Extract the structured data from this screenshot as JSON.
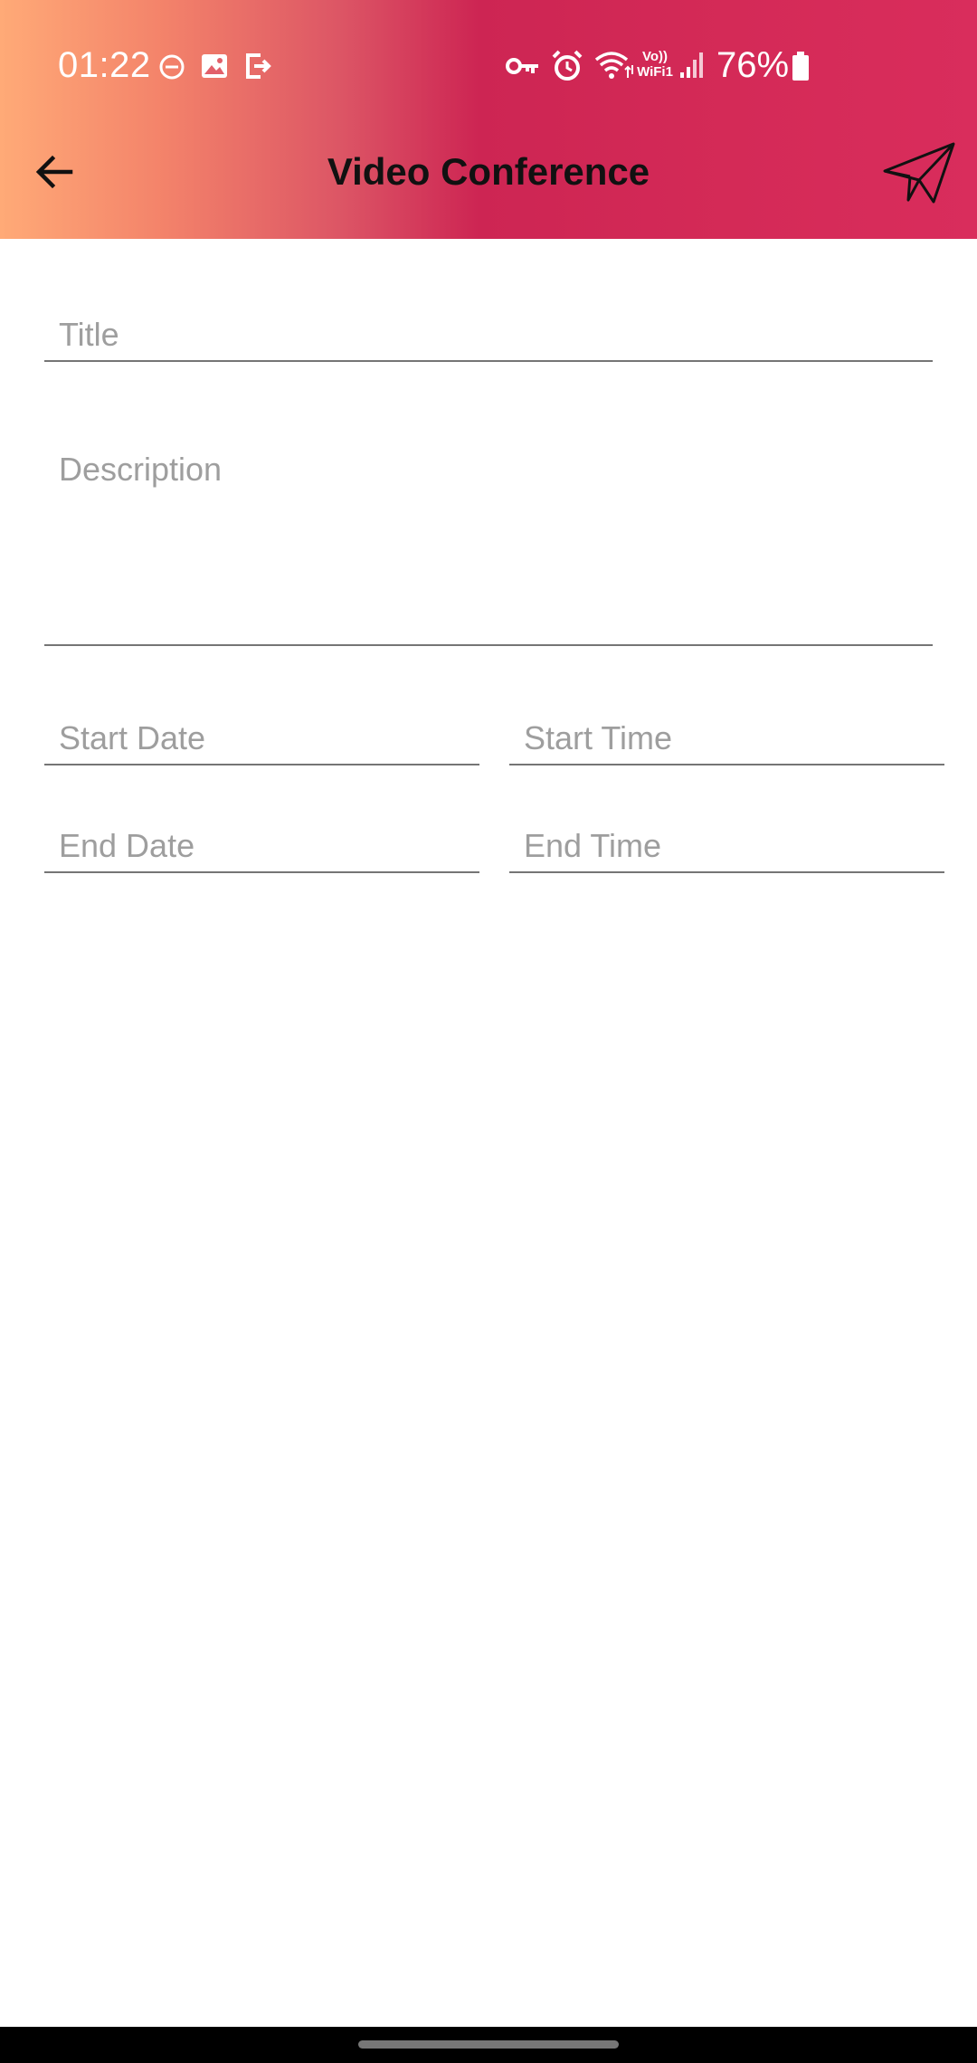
{
  "status_bar": {
    "time": "01:22",
    "battery_percent": "76%",
    "vowifi_top": "Vo))",
    "vowifi_bottom": "WiFi1",
    "icons": [
      "dnd-icon",
      "gallery-icon",
      "exit-icon",
      "vpn-key-icon",
      "alarm-icon",
      "wifi-icon",
      "vowifi-icon",
      "signal-icon",
      "battery-icon"
    ]
  },
  "toolbar": {
    "title": "Video Conference",
    "back_icon": "arrow-left-icon",
    "send_icon": "paper-plane-icon"
  },
  "form": {
    "title_placeholder": "Title",
    "description_placeholder": "Description",
    "start_date_placeholder": "Start Date",
    "start_time_placeholder": "Start Time",
    "end_date_placeholder": "End Date",
    "end_time_placeholder": "End Time"
  },
  "colors": {
    "gradient_start": "#ffaa77",
    "gradient_end": "#d92d5c",
    "underline": "#757575",
    "placeholder": "#9e9e9e"
  }
}
